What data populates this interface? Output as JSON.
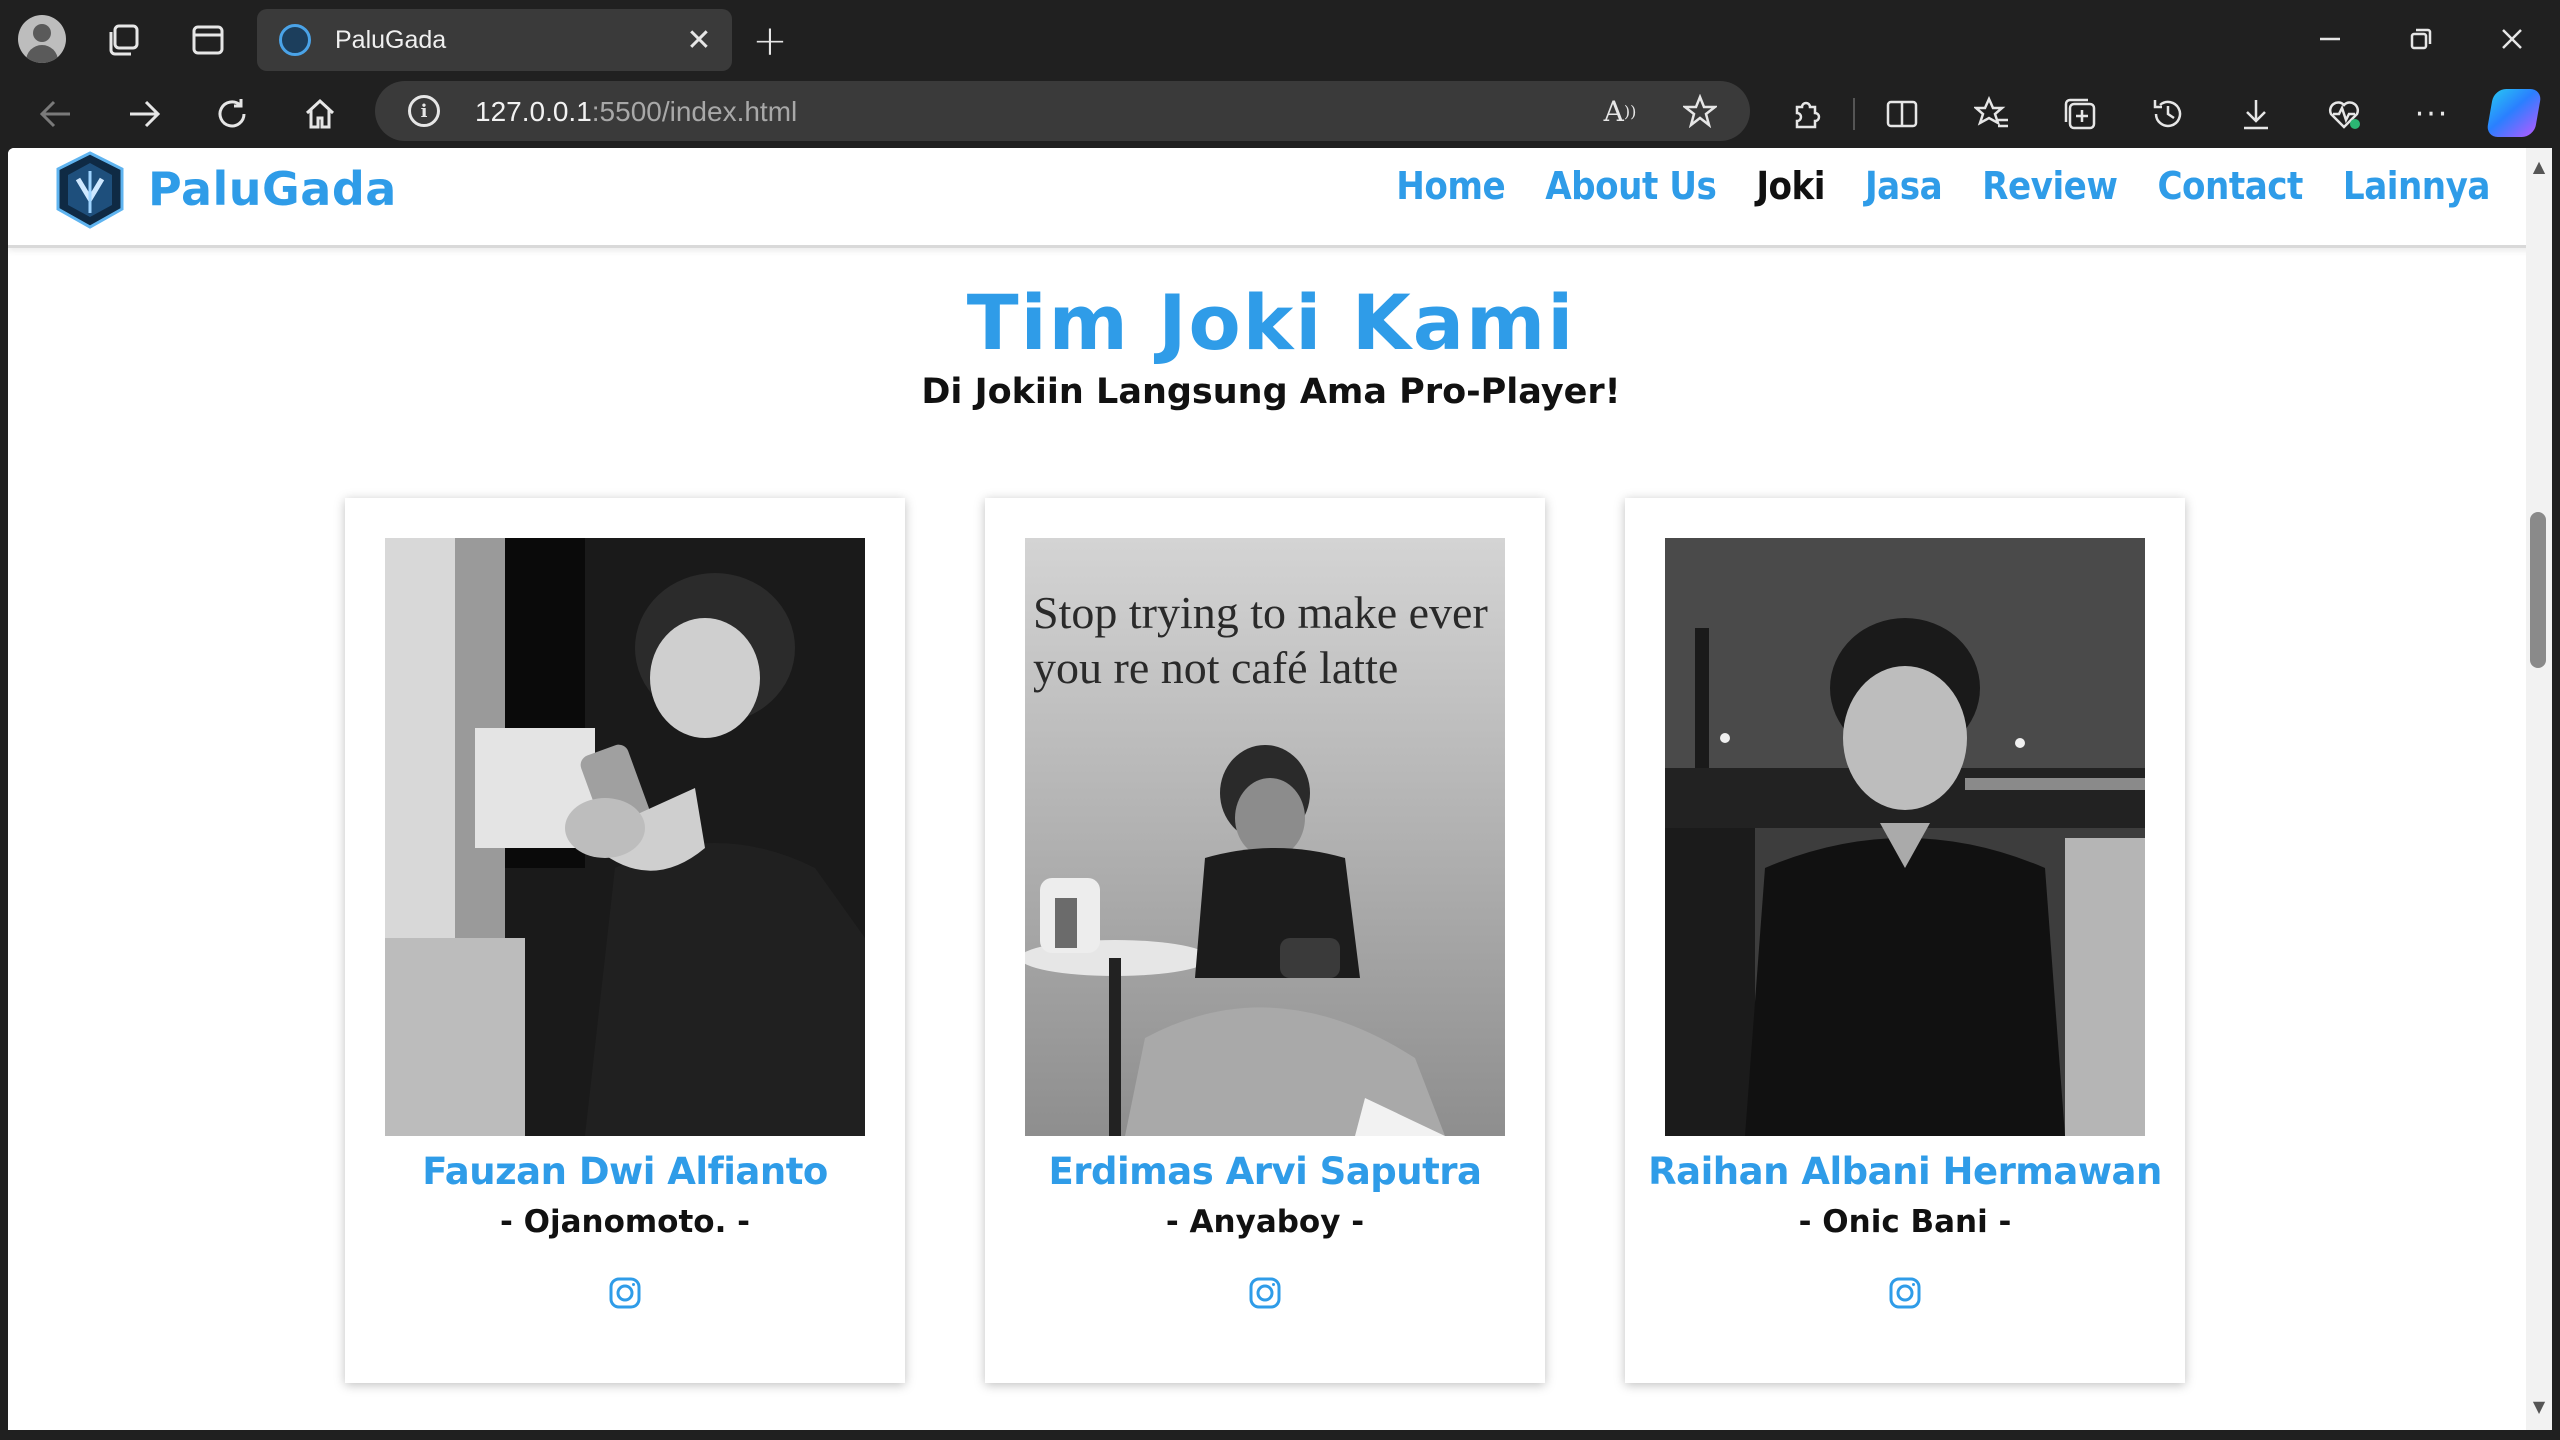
{
  "browser": {
    "tab_title": "PaluGada",
    "tab_close_glyph": "✕",
    "new_tab_glyph": "+",
    "url_host": "127.0.0.1",
    "url_rest": ":5500/index.html"
  },
  "site": {
    "brand": "PaluGada",
    "nav": [
      {
        "label": "Home",
        "active": false
      },
      {
        "label": "About Us",
        "active": false
      },
      {
        "label": "Joki",
        "active": true
      },
      {
        "label": "Jasa",
        "active": false
      },
      {
        "label": "Review",
        "active": false
      },
      {
        "label": "Contact",
        "active": false
      },
      {
        "label": "Lainnya",
        "active": false
      }
    ]
  },
  "section": {
    "title": "Tim Joki Kami",
    "subtitle": "Di Jokiin Langsung Ama Pro-Player!"
  },
  "team": [
    {
      "name": "Fauzan Dwi Alfianto",
      "nickname": "- Ojanomoto. -",
      "icon": "instagram-icon"
    },
    {
      "name": "Erdimas Arvi Saputra",
      "nickname": "- Anyaboy -",
      "icon": "instagram-icon",
      "photo_text": "Stop trying to make ever you re not café latte"
    },
    {
      "name": "Raihan Albani Hermawan",
      "nickname": "- Onic Bani -",
      "icon": "instagram-icon"
    }
  ],
  "colors": {
    "accent": "#2f9ce8",
    "text_dark": "#111111",
    "chrome_bg": "#202020",
    "omnibox_bg": "#3a3a3a"
  }
}
